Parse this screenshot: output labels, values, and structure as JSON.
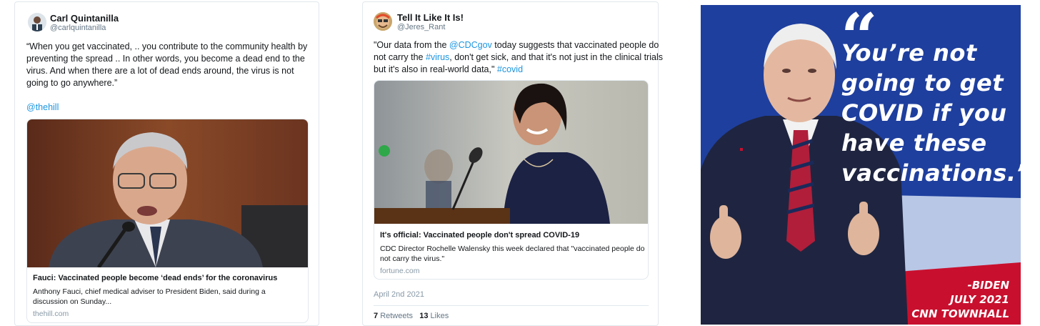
{
  "left_tweet": {
    "name": "Carl Quintanilla",
    "handle": "@carlquintanilla",
    "text_lines": [
      "“When you get vaccinated, .. you contribute to the community health by",
      "preventing the spread .. In other words, you become a dead end to the",
      "virus. And when there are a lot of dead ends around, the virus is not",
      "going to go anywhere.”"
    ],
    "mention": "@thehill",
    "card": {
      "title": "Fauci: Vaccinated people become ‘dead ends’ for the coronavirus",
      "desc_lines": [
        "Anthony Fauci, chief medical adviser to President Biden, said during a",
        "discussion on Sunday..."
      ],
      "domain": "thehill.com"
    }
  },
  "mid_tweet": {
    "name": "Tell It Like It Is!",
    "handle": "@Jeres_Rant",
    "line1_a": "\"Our data from the ",
    "line1_mention": "@CDCgov",
    "line1_b": " today suggests that vaccinated people do",
    "line2_a": "not carry the ",
    "line2_hashtag": "#virus",
    "line2_b": ", don't get sick, and that it's not just in the clinical trials",
    "line3_a": "but it's also in real-world data,\"  ",
    "line3_hashtag": "#covid",
    "card": {
      "title": "It's official: Vaccinated people don't spread COVID-19",
      "desc_lines": [
        "CDC Director Rochelle Walensky this week declared that \"vaccinated people do",
        "not carry the virus.\""
      ],
      "domain": "fortune.com"
    },
    "date": "April 2nd 2021",
    "retweets_count": "7",
    "retweets_label": "Retweets",
    "likes_count": "13",
    "likes_label": "Likes"
  },
  "poster": {
    "quote_mark": "“",
    "quote_lines": [
      "You’re not",
      "going to get",
      "COVID if you",
      "have these",
      "vaccinations.”"
    ],
    "credit_lines": [
      "-BIDEN",
      "JULY 2021",
      "CNN TOWNHALL"
    ]
  },
  "colors": {
    "link": "#1b95e0",
    "poster_blue": "#1d3d9c",
    "poster_red": "#c8102e"
  }
}
